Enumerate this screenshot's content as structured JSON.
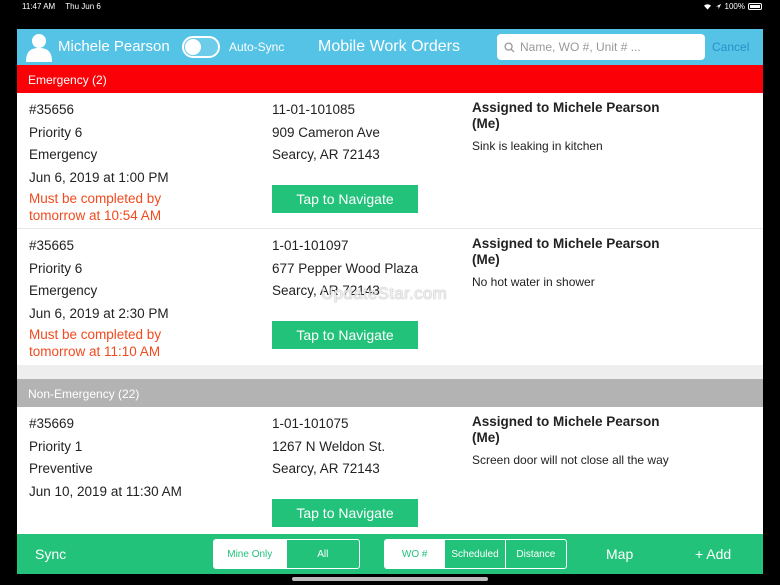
{
  "status_bar": {
    "time": "11:47 AM",
    "date": "Thu Jun 6",
    "battery": "100%"
  },
  "header": {
    "user_name": "Michele Pearson",
    "auto_sync_label": "Auto-Sync",
    "title": "Mobile Work Orders",
    "search_placeholder": "Name, WO #, Unit # ...",
    "cancel_label": "Cancel"
  },
  "sections": {
    "emergency": "Emergency (2)",
    "non_emergency": "Non-Emergency (22)"
  },
  "work_orders": [
    {
      "number": "#35656",
      "priority": "Priority 6",
      "category": "Emergency",
      "date": "Jun 6, 2019 at 1:00 PM",
      "due_line1": "Must be completed by",
      "due_line2": "tomorrow at 10:54 AM",
      "unit": "11-01-101085",
      "street": "909 Cameron Ave",
      "city": "Searcy, AR 72143",
      "navigate": "Tap to Navigate",
      "assigned_line1": "Assigned to Michele Pearson",
      "assigned_line2": "(Me)",
      "description": "Sink is leaking in kitchen"
    },
    {
      "number": "#35665",
      "priority": "Priority 6",
      "category": "Emergency",
      "date": "Jun 6, 2019 at 2:30 PM",
      "due_line1": "Must be completed by",
      "due_line2": "tomorrow at 11:10 AM",
      "unit": "1-01-101097",
      "street": "677 Pepper Wood Plaza",
      "city": "Searcy, AR 72143",
      "navigate": "Tap to Navigate",
      "assigned_line1": "Assigned to Michele Pearson",
      "assigned_line2": "(Me)",
      "description": "No hot water in shower"
    },
    {
      "number": "#35669",
      "priority": "Priority 1",
      "category": "Preventive",
      "date": "Jun 10, 2019 at 11:30 AM",
      "unit": "1-01-101075",
      "street": "1267 N Weldon St.",
      "city": "Searcy, AR 72143",
      "navigate": "Tap to Navigate",
      "assigned_line1": "Assigned to Michele Pearson",
      "assigned_line2": "(Me)",
      "description": "Screen door will not close all the way"
    }
  ],
  "watermark": "UpdateStar.com",
  "footer": {
    "sync": "Sync",
    "owner_filter": [
      "Mine Only",
      "All"
    ],
    "sort_options": [
      "WO #",
      "Scheduled",
      "Distance"
    ],
    "map": "Map",
    "add": "+ Add"
  },
  "colors": {
    "header": "#54c3e6",
    "emergency": "#fb0007",
    "non_emergency": "#b3b3b3",
    "accent_green": "#22c27a",
    "due_text": "#f04a1e"
  },
  "icons": [
    "user-avatar-icon",
    "search-icon",
    "wifi-icon",
    "location-icon",
    "battery-icon"
  ]
}
